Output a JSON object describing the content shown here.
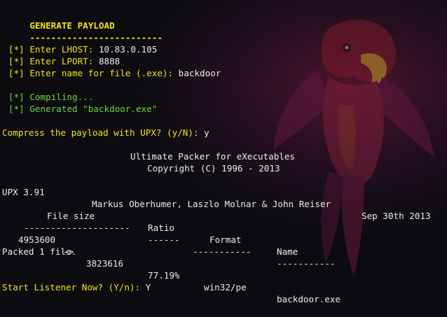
{
  "terminal": {
    "header_title": "GENERATE PAYLOAD",
    "header_rule": "-------------------------",
    "prompt_marker": "[*]",
    "lhost_prompt": "Enter LHOST:",
    "lhost_value": "10.83.0.105",
    "lport_prompt": "Enter LPORT:",
    "lport_value": "8888",
    "filename_prompt": "Enter name for file (.exe):",
    "filename_value": "backdoor",
    "compiling_msg": "Compiling...",
    "generated_msg": "Generated \"backdoor.exe\"",
    "upx_prompt": "Compress the payload with UPX? (y/N):",
    "upx_answer": "y",
    "upx_banner_line1": "Ultimate Packer for eXecutables",
    "upx_banner_line2": "Copyright (C) 1996 - 2013",
    "upx_version": "UPX 3.91",
    "upx_authors": "Markus Oberhumer, Laszlo Molnar & John Reiser",
    "upx_date": "Sep 30th 2013",
    "table": {
      "col_file_size": "File size",
      "col_ratio": "Ratio",
      "col_format": "Format",
      "col_name": "Name",
      "rule_file_size": "--------------------",
      "rule_ratio": "------",
      "rule_format": "-----------",
      "rule_name": "-----------",
      "row": {
        "original_size": "4953600",
        "arrow": "->",
        "packed_size": "3823616",
        "ratio": "77.19%",
        "format": "win32/pe",
        "name": "backdoor.exe"
      }
    },
    "packed_msg": "Packed 1 file.",
    "listener_prompt": "Start Listener Now? (Y/n):",
    "listener_answer": "Y"
  },
  "colors": {
    "background": "#0c0c10",
    "yellow": "#f2e21a",
    "white": "#ededed",
    "green": "#6fd63c"
  },
  "icons": {
    "wallpaper": "parrot-logo-icon"
  }
}
